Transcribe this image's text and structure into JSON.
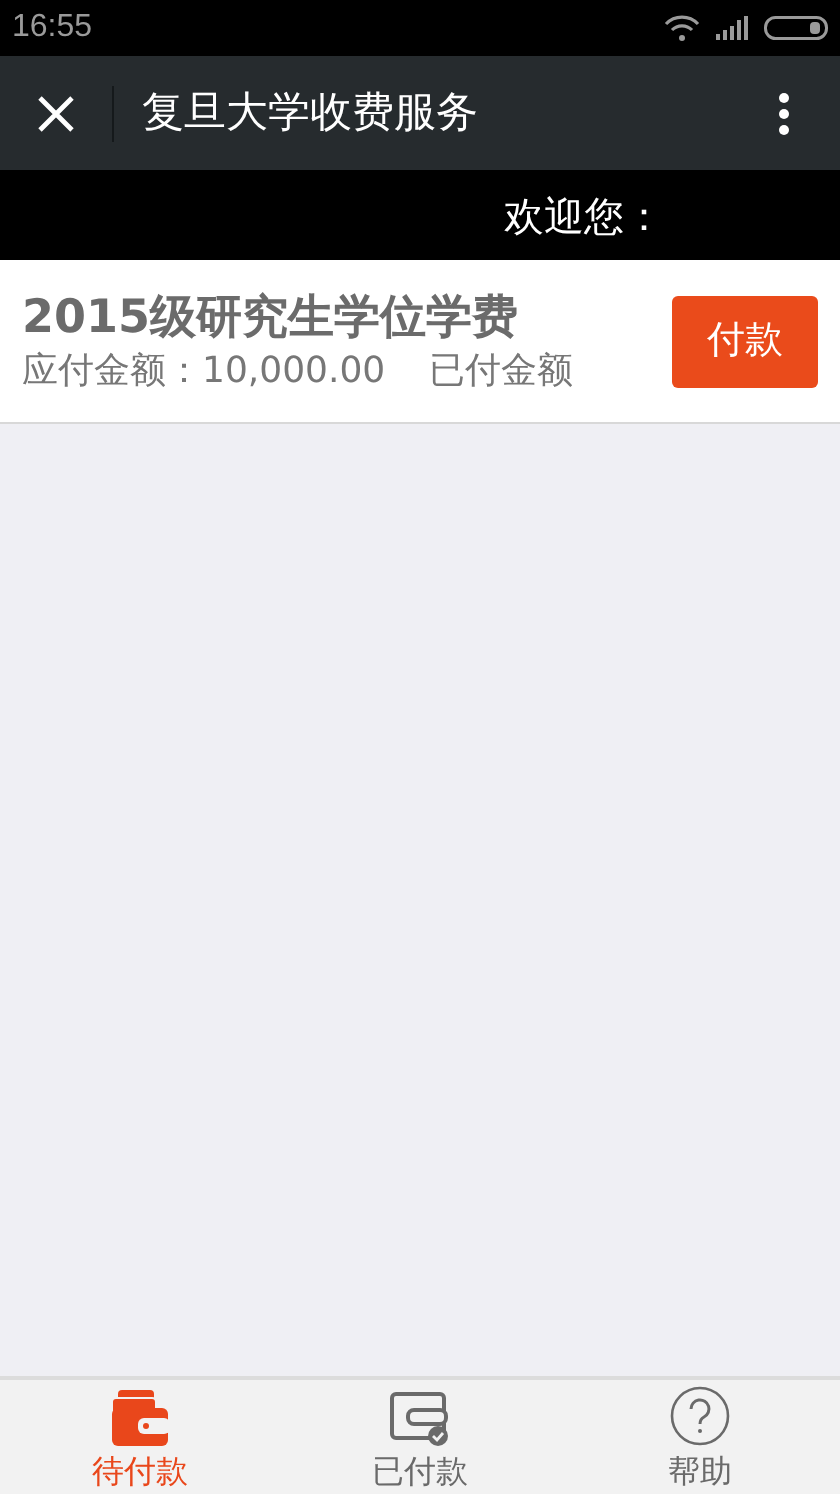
{
  "status_bar": {
    "time": "16:55"
  },
  "toolbar": {
    "title": "复旦大学收费服务"
  },
  "welcome": "欢迎您：",
  "bills": [
    {
      "title": "2015级研究生学位学费",
      "amount_due": "应付金额：10,000.00",
      "paid_label": "已付金额",
      "button": "付款"
    }
  ],
  "tabs": [
    {
      "label": "待付款",
      "selected": true
    },
    {
      "label": "已付款",
      "selected": false
    },
    {
      "label": "帮助",
      "selected": false
    }
  ]
}
